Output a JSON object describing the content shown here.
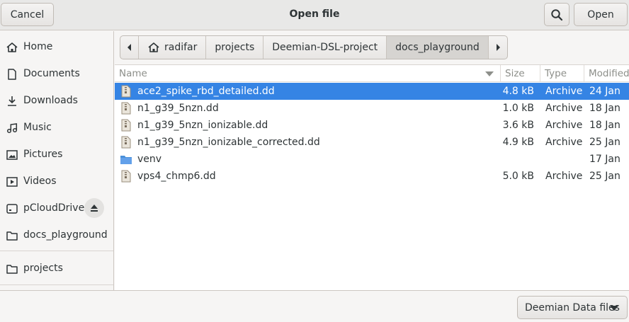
{
  "header": {
    "cancel_label": "Cancel",
    "title": "Open file",
    "search_icon": "search-icon",
    "open_label": "Open"
  },
  "sidebar": {
    "items": [
      {
        "label": "Home",
        "icon": "home-icon"
      },
      {
        "label": "Documents",
        "icon": "document-icon"
      },
      {
        "label": "Downloads",
        "icon": "download-icon"
      },
      {
        "label": "Music",
        "icon": "music-icon"
      },
      {
        "label": "Pictures",
        "icon": "picture-icon"
      },
      {
        "label": "Videos",
        "icon": "video-icon"
      },
      {
        "label": "pCloudDrive",
        "icon": "drive-icon",
        "eject_icon": "eject-icon"
      },
      {
        "label": "docs_playground",
        "icon": "folder-icon"
      },
      {
        "label": "projects",
        "icon": "folder-icon"
      }
    ]
  },
  "pathbar": {
    "back_icon": "chevron-left-icon",
    "forward_icon": "chevron-right-icon",
    "segments": [
      {
        "label": "radifar",
        "icon": "home-icon"
      },
      {
        "label": "projects"
      },
      {
        "label": "Deemian-DSL-project"
      },
      {
        "label": "docs_playground",
        "active": true
      }
    ]
  },
  "filelist": {
    "columns": {
      "name": "Name",
      "size": "Size",
      "type": "Type",
      "modified": "Modified"
    },
    "sort_icon": "sort-descending-icon",
    "rows": [
      {
        "name": "ace2_spike_rbd_detailed.dd",
        "size": "4.8 kB",
        "type": "Archive",
        "modified": "24 Jan",
        "icon": "archive-icon",
        "selected": true
      },
      {
        "name": "n1_g39_5nzn.dd",
        "size": "1.0 kB",
        "type": "Archive",
        "modified": "18 Jan",
        "icon": "archive-icon"
      },
      {
        "name": "n1_g39_5nzn_ionizable.dd",
        "size": "3.6 kB",
        "type": "Archive",
        "modified": "18 Jan",
        "icon": "archive-icon"
      },
      {
        "name": "n1_g39_5nzn_ionizable_corrected.dd",
        "size": "4.9 kB",
        "type": "Archive",
        "modified": "25 Jan",
        "icon": "archive-icon"
      },
      {
        "name": "venv",
        "size": "",
        "type": "",
        "modified": "17 Jan",
        "icon": "folder-icon"
      },
      {
        "name": "vps4_chmp6.dd",
        "size": "5.0 kB",
        "type": "Archive",
        "modified": "25 Jan",
        "icon": "archive-icon"
      }
    ]
  },
  "footer": {
    "filter_label": "Deemian Data files",
    "filter_icon": "chevron-down-icon"
  },
  "colors": {
    "accent": "#3584e4",
    "folder": "#4a90d9"
  }
}
